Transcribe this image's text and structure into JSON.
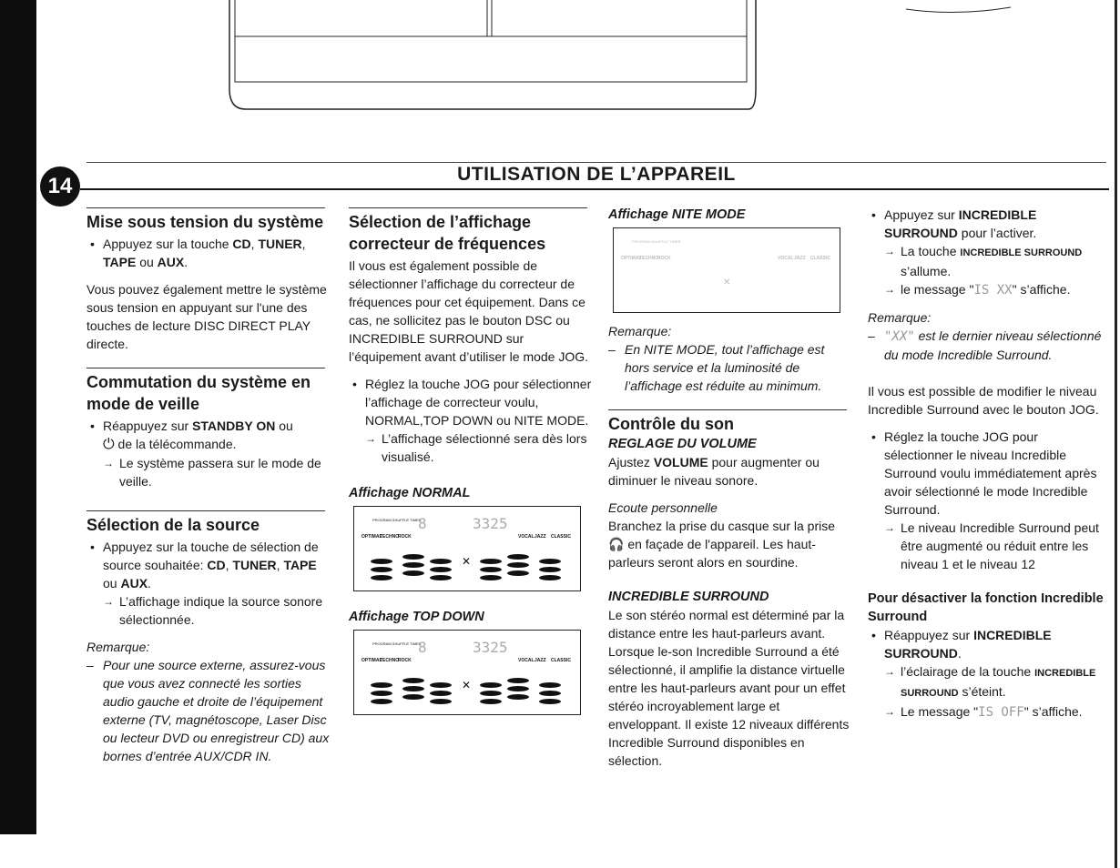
{
  "page": {
    "number": "14",
    "title": "UTILISATION DE L’APPAREIL"
  },
  "col1": {
    "h1": "Mise sous tension du système",
    "b1": {
      "pre": "Appuyez sur la touche ",
      "k1": "CD",
      "s1": ", ",
      "k2": "TUNER",
      "s2": ", ",
      "k3": "TAPE",
      "s3": " ou ",
      "k4": "AUX",
      "end": "."
    },
    "p1": "Vous pouvez également mettre le système sous tension en appuyant sur l'une des touches de lecture DISC DIRECT PLAY directe.",
    "h2": "Commutation du système en mode de veille",
    "b2": {
      "pre": "Réappuyez sur ",
      "k1": "STANDBY ON",
      "post": " ou",
      "line2": " de la télécommande.",
      "arrow": "Le système passera sur le mode de veille."
    },
    "h3": "Sélection de la source",
    "b3": {
      "pre": "Appuyez sur la touche de sélection de source souhaitée: ",
      "k1": "CD",
      "s1": ", ",
      "k2": "TUNER",
      "s2": ", ",
      "k3": "TAPE",
      "s3": " ou ",
      "k4": "AUX",
      "end": ".",
      "arrow": "L’affichage indique la source sonore sélectionnée."
    },
    "remark": "Remarque:",
    "note": "Pour une source externe, assurez-vous que vous avez connecté les sorties audio gauche et droite de l’équipement externe (TV, magnétoscope, Laser Disc ou lecteur DVD ou enregistreur CD) aux bornes d’entrée AUX/CDR IN."
  },
  "col2": {
    "h1": "Sélection de l’affichage correcteur de fréquences",
    "p1": "Il vous est également possible de sélectionner l’affichage du correcteur de fréquences pour cet équipement. Dans ce cas, ne sollicitez pas le bouton DSC ou INCREDIBLE SURROUND sur l’équipement avant d’utiliser le mode JOG.",
    "b1": "Réglez la touche JOG pour sélectionner l’affichage de correcteur voulu, NORMAL,TOP DOWN ou NITE MODE.",
    "a1": "L’affichage sélectionné sera dès lors visualisé.",
    "normal_label": "Affichage NORMAL",
    "topdown_label": "Affichage TOP DOWN"
  },
  "display": {
    "digit": "8",
    "counter": "3325",
    "modes_left": [
      "OPTIMAL",
      "TECHNO",
      "ROCK"
    ],
    "modes_right": [
      "VOCAL",
      "JAZZ",
      "CLASSIC"
    ],
    "top_left": "PROGRAM SHUFFLE TIMER"
  },
  "col3": {
    "nite_label": "Affichage NITE MODE",
    "remark": "Remarque:",
    "note": "En NITE MODE, tout l’affichage est hors service et la luminosité de l’affichage est réduite au minimum.",
    "h1": "Contrôle du son",
    "s1": "REGLAGE DU VOLUME",
    "p1": {
      "pre": "Ajustez ",
      "k": "VOLUME",
      "post": " pour augmenter ou diminuer le niveau sonore."
    },
    "s2": "Ecoute personnelle",
    "p2": {
      "pre": "Branchez la prise du casque sur la prise ",
      "post": " en façade de l'appareil. Les haut-parleurs seront alors en sourdine."
    },
    "s3": "INCREDIBLE SURROUND",
    "p3": "Le son stéréo normal est déterminé par la distance entre les haut-parleurs avant. Lorsque le-son Incredible Surround a été sélectionné, il amplifie la distance virtuelle entre les haut-parleurs avant pour un effet stéréo incroyablement large et enveloppant. Il existe 12 niveaux différents Incredible Surround disponibles en sélection."
  },
  "col4": {
    "b1": {
      "pre": "Appuyez sur ",
      "k": "INCREDIBLE SURROUND",
      "post": " pour l’activer."
    },
    "a1": {
      "pre": "La touche ",
      "k": "INCREDIBLE SURROUND",
      "post": " s’allume."
    },
    "a2": {
      "pre": "le message \"",
      "lcd": "IS XX",
      "post": "\" s’affiche."
    },
    "remark": "Remarque:",
    "note": {
      "lcd": "\"XX\"",
      "post": " est le dernier niveau sélectionné du mode Incredible Surround."
    },
    "p1": "Il vous est possible de modifier le niveau Incredible Surround avec le bouton JOG.",
    "b2": "Réglez la touche JOG pour sélectionner le niveau Incredible Surround voulu immédiatement après avoir sélectionné le mode Incredible Surround.",
    "a3": "Le niveau Incredible Surround peut être augmenté ou réduit entre les niveau 1 et le niveau 12",
    "h1": "Pour désactiver la fonction Incredible Surround",
    "b3": {
      "pre": "Réappuyez sur ",
      "k": "INCREDIBLE SURROUND",
      "end": "."
    },
    "a4": {
      "pre": "l’éclairage de la touche ",
      "k": "INCREDIBLE SURROUND",
      "post": " s’éteint."
    },
    "a5": {
      "pre": "Le message \"",
      "lcd": "IS OFF",
      "post": "\" s’affiche."
    }
  }
}
